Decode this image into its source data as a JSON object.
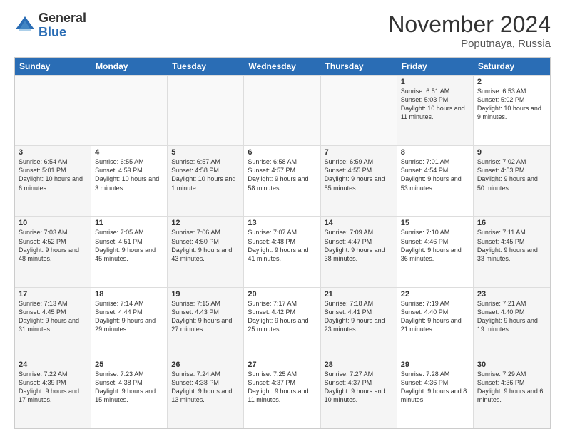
{
  "header": {
    "logo_general": "General",
    "logo_blue": "Blue",
    "month_title": "November 2024",
    "location": "Poputnaya, Russia"
  },
  "days_of_week": [
    "Sunday",
    "Monday",
    "Tuesday",
    "Wednesday",
    "Thursday",
    "Friday",
    "Saturday"
  ],
  "rows": [
    [
      {
        "day": "",
        "text": "",
        "empty": true
      },
      {
        "day": "",
        "text": "",
        "empty": true
      },
      {
        "day": "",
        "text": "",
        "empty": true
      },
      {
        "day": "",
        "text": "",
        "empty": true
      },
      {
        "day": "",
        "text": "",
        "empty": true
      },
      {
        "day": "1",
        "text": "Sunrise: 6:51 AM\nSunset: 5:03 PM\nDaylight: 10 hours\nand 11 minutes.",
        "shaded": true
      },
      {
        "day": "2",
        "text": "Sunrise: 6:53 AM\nSunset: 5:02 PM\nDaylight: 10 hours\nand 9 minutes.",
        "shaded": false
      }
    ],
    [
      {
        "day": "3",
        "text": "Sunrise: 6:54 AM\nSunset: 5:01 PM\nDaylight: 10 hours\nand 6 minutes.",
        "shaded": true
      },
      {
        "day": "4",
        "text": "Sunrise: 6:55 AM\nSunset: 4:59 PM\nDaylight: 10 hours\nand 3 minutes.",
        "shaded": false
      },
      {
        "day": "5",
        "text": "Sunrise: 6:57 AM\nSunset: 4:58 PM\nDaylight: 10 hours\nand 1 minute.",
        "shaded": true
      },
      {
        "day": "6",
        "text": "Sunrise: 6:58 AM\nSunset: 4:57 PM\nDaylight: 9 hours\nand 58 minutes.",
        "shaded": false
      },
      {
        "day": "7",
        "text": "Sunrise: 6:59 AM\nSunset: 4:55 PM\nDaylight: 9 hours\nand 55 minutes.",
        "shaded": true
      },
      {
        "day": "8",
        "text": "Sunrise: 7:01 AM\nSunset: 4:54 PM\nDaylight: 9 hours\nand 53 minutes.",
        "shaded": false
      },
      {
        "day": "9",
        "text": "Sunrise: 7:02 AM\nSunset: 4:53 PM\nDaylight: 9 hours\nand 50 minutes.",
        "shaded": true
      }
    ],
    [
      {
        "day": "10",
        "text": "Sunrise: 7:03 AM\nSunset: 4:52 PM\nDaylight: 9 hours\nand 48 minutes.",
        "shaded": true
      },
      {
        "day": "11",
        "text": "Sunrise: 7:05 AM\nSunset: 4:51 PM\nDaylight: 9 hours\nand 45 minutes.",
        "shaded": false
      },
      {
        "day": "12",
        "text": "Sunrise: 7:06 AM\nSunset: 4:50 PM\nDaylight: 9 hours\nand 43 minutes.",
        "shaded": true
      },
      {
        "day": "13",
        "text": "Sunrise: 7:07 AM\nSunset: 4:48 PM\nDaylight: 9 hours\nand 41 minutes.",
        "shaded": false
      },
      {
        "day": "14",
        "text": "Sunrise: 7:09 AM\nSunset: 4:47 PM\nDaylight: 9 hours\nand 38 minutes.",
        "shaded": true
      },
      {
        "day": "15",
        "text": "Sunrise: 7:10 AM\nSunset: 4:46 PM\nDaylight: 9 hours\nand 36 minutes.",
        "shaded": false
      },
      {
        "day": "16",
        "text": "Sunrise: 7:11 AM\nSunset: 4:45 PM\nDaylight: 9 hours\nand 33 minutes.",
        "shaded": true
      }
    ],
    [
      {
        "day": "17",
        "text": "Sunrise: 7:13 AM\nSunset: 4:45 PM\nDaylight: 9 hours\nand 31 minutes.",
        "shaded": true
      },
      {
        "day": "18",
        "text": "Sunrise: 7:14 AM\nSunset: 4:44 PM\nDaylight: 9 hours\nand 29 minutes.",
        "shaded": false
      },
      {
        "day": "19",
        "text": "Sunrise: 7:15 AM\nSunset: 4:43 PM\nDaylight: 9 hours\nand 27 minutes.",
        "shaded": true
      },
      {
        "day": "20",
        "text": "Sunrise: 7:17 AM\nSunset: 4:42 PM\nDaylight: 9 hours\nand 25 minutes.",
        "shaded": false
      },
      {
        "day": "21",
        "text": "Sunrise: 7:18 AM\nSunset: 4:41 PM\nDaylight: 9 hours\nand 23 minutes.",
        "shaded": true
      },
      {
        "day": "22",
        "text": "Sunrise: 7:19 AM\nSunset: 4:40 PM\nDaylight: 9 hours\nand 21 minutes.",
        "shaded": false
      },
      {
        "day": "23",
        "text": "Sunrise: 7:21 AM\nSunset: 4:40 PM\nDaylight: 9 hours\nand 19 minutes.",
        "shaded": true
      }
    ],
    [
      {
        "day": "24",
        "text": "Sunrise: 7:22 AM\nSunset: 4:39 PM\nDaylight: 9 hours\nand 17 minutes.",
        "shaded": true
      },
      {
        "day": "25",
        "text": "Sunrise: 7:23 AM\nSunset: 4:38 PM\nDaylight: 9 hours\nand 15 minutes.",
        "shaded": false
      },
      {
        "day": "26",
        "text": "Sunrise: 7:24 AM\nSunset: 4:38 PM\nDaylight: 9 hours\nand 13 minutes.",
        "shaded": true
      },
      {
        "day": "27",
        "text": "Sunrise: 7:25 AM\nSunset: 4:37 PM\nDaylight: 9 hours\nand 11 minutes.",
        "shaded": false
      },
      {
        "day": "28",
        "text": "Sunrise: 7:27 AM\nSunset: 4:37 PM\nDaylight: 9 hours\nand 10 minutes.",
        "shaded": true
      },
      {
        "day": "29",
        "text": "Sunrise: 7:28 AM\nSunset: 4:36 PM\nDaylight: 9 hours\nand 8 minutes.",
        "shaded": false
      },
      {
        "day": "30",
        "text": "Sunrise: 7:29 AM\nSunset: 4:36 PM\nDaylight: 9 hours\nand 6 minutes.",
        "shaded": true
      }
    ]
  ]
}
